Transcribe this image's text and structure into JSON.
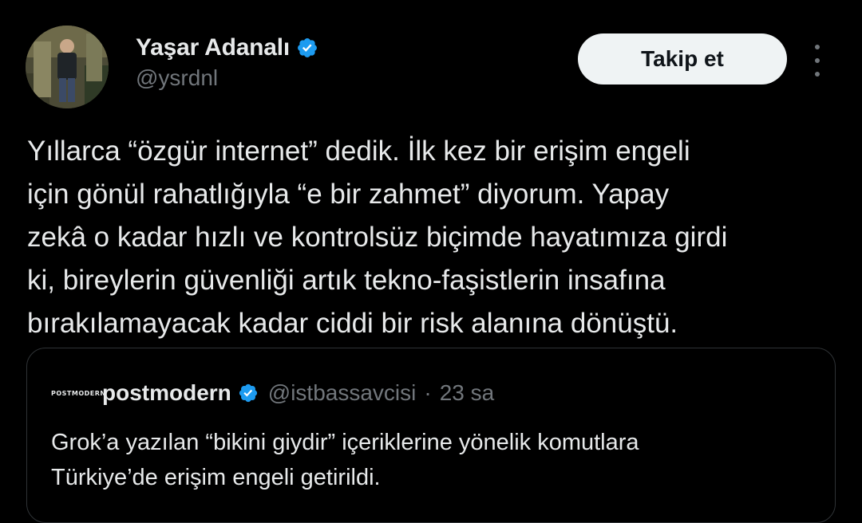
{
  "author": {
    "display_name": "Yaşar Adanalı",
    "handle": "@ysrdnl",
    "verified_icon": "verified-badge-icon",
    "avatar_icon": "profile-photo"
  },
  "follow_button": {
    "label": "Takip et"
  },
  "more_button": {
    "icon": "more-vertical-icon"
  },
  "tweet": {
    "text": "Yıllarca “özgür internet” dedik. İlk kez bir erişim engeli\niçin gönül rahatlığıyla “e bir zahmet” diyorum. Yapay\nzekâ o kadar hızlı ve kontrolsüz biçimde hayatımıza girdi\nki, bireylerin güvenliği artık tekno-faşistlerin insafına\nbırakılamayacak kadar ciddi bir risk alanına dönüştü."
  },
  "quoted_tweet": {
    "avatar_text": "POSTMODERN",
    "display_name": "postmodern",
    "handle": "@istbassavcisi",
    "separator": "·",
    "time": "23 sa",
    "text": "Grok’a yazılan “bikini giydir” içeriklerine yönelik komutlara\nTürkiye’de erişim engeli getirildi."
  },
  "colors": {
    "background": "#000000",
    "text": "#e7e9ea",
    "secondary_text": "#71767b",
    "verified": "#1d9bf0",
    "border": "#2f3336",
    "button_bg": "#eff3f4"
  }
}
